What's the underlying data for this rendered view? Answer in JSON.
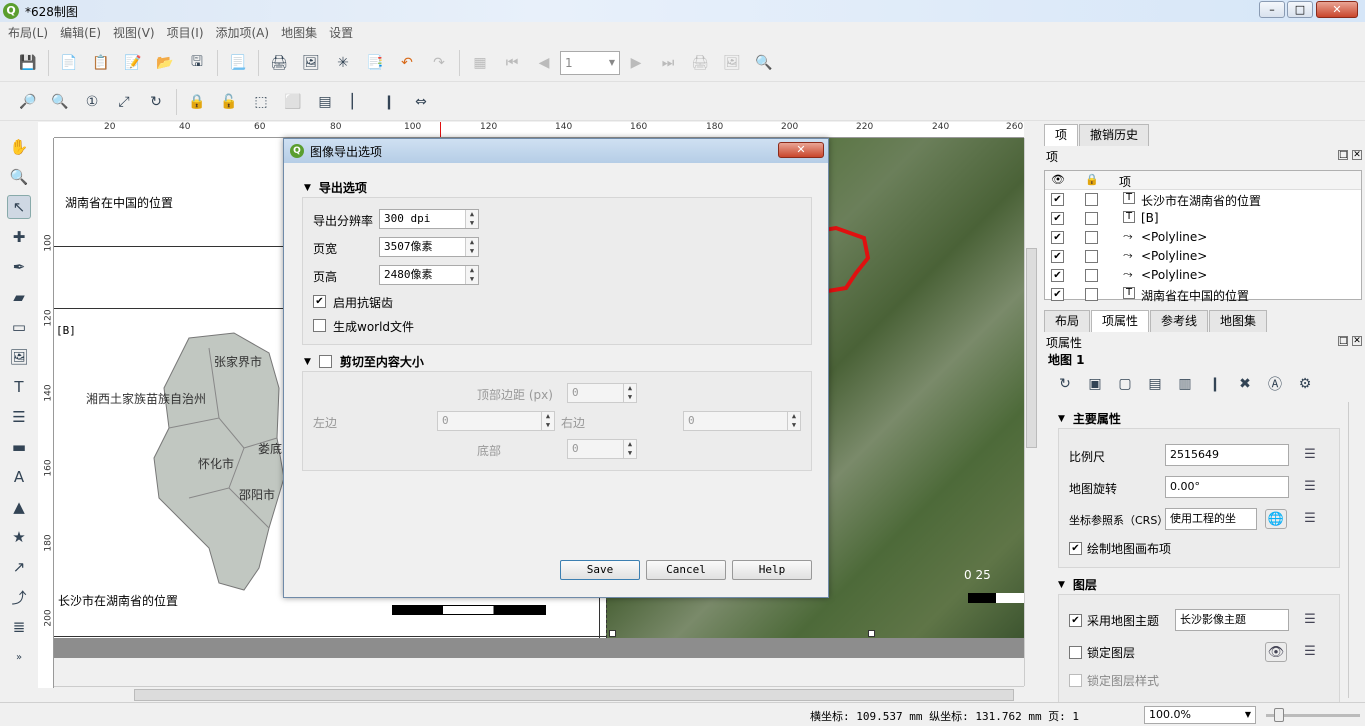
{
  "window": {
    "title": "*628制图"
  },
  "menu": [
    "布局(L)",
    "编辑(E)",
    "视图(V)",
    "项目(I)",
    "添加项(A)",
    "地图集",
    "设置"
  ],
  "toolbar": {
    "page_value": "1"
  },
  "rulers": {
    "h_ticks": [
      "20",
      "40",
      "60",
      "80",
      "100",
      "120",
      "140",
      "160",
      "180",
      "200",
      "220",
      "240",
      "260"
    ],
    "v_ticks": [
      "100",
      "120",
      "140",
      "160",
      "180",
      "200"
    ]
  },
  "layout": {
    "title_top": "湖南省在中国的位置",
    "label_b": "[B]",
    "title_bottom": "长沙市在湖南省的位置",
    "places": [
      "张家界市",
      "湘西土家族苗族自治州",
      "怀化市",
      "娄底",
      "邵阳市"
    ],
    "scale_label": "0   25"
  },
  "dialog": {
    "title": "图像导出选项",
    "group1": "导出选项",
    "resolution_label": "导出分辨率",
    "resolution_value": "300 dpi",
    "width_label": "页宽",
    "width_value": "3507像素",
    "height_label": "页高",
    "height_value": "2480像素",
    "antialias_label": "启用抗锯齿",
    "antialias_checked": true,
    "world_label": "生成world文件",
    "world_checked": false,
    "group2": "剪切至内容大小",
    "top_label": "顶部边距 (px)",
    "left_label": "左边",
    "right_label": "右边",
    "bottom_label": "底部",
    "margin_value": "0",
    "save": "Save",
    "cancel": "Cancel",
    "help": "Help"
  },
  "right_panel": {
    "tabs_top": [
      "项",
      "撤销历史"
    ],
    "items_header": "项",
    "items_col": "项",
    "items": [
      {
        "visible": true,
        "name": "长沙市在湖南省的位置",
        "icon": "text-icon"
      },
      {
        "visible": true,
        "name": "[B]",
        "icon": "text-icon"
      },
      {
        "visible": true,
        "name": "<Polyline>",
        "icon": "polyline-icon"
      },
      {
        "visible": true,
        "name": "<Polyline>",
        "icon": "polyline-icon"
      },
      {
        "visible": true,
        "name": "<Polyline>",
        "icon": "polyline-icon"
      },
      {
        "visible": true,
        "name": "湖南省在中国的位置",
        "icon": "text-icon"
      }
    ],
    "tabs_mid": [
      "布局",
      "项属性",
      "参考线",
      "地图集"
    ],
    "props_header": "项属性",
    "map_name": "地图 1",
    "main_props": "主要属性",
    "scale_label": "比例尺",
    "scale_value": "2515649",
    "rotation_label": "地图旋转",
    "rotation_value": "0.00°",
    "crs_label": "坐标参照系（CRS）",
    "crs_value": "使用工程的坐",
    "draw_canvas_label": "绘制地图画布项",
    "layers_header": "图层",
    "use_theme_label": "采用地图主题",
    "theme_value": "长沙影像主题",
    "lock_layers_label": "锁定图层",
    "lock_styles_label": "锁定图层样式"
  },
  "status": {
    "coords": "横坐标: 109.537 mm 纵坐标: 131.762 mm 页: 1",
    "zoom": "100.0%"
  },
  "colors": {
    "boundary": "#e01010",
    "accent": "#5a9e2f"
  }
}
